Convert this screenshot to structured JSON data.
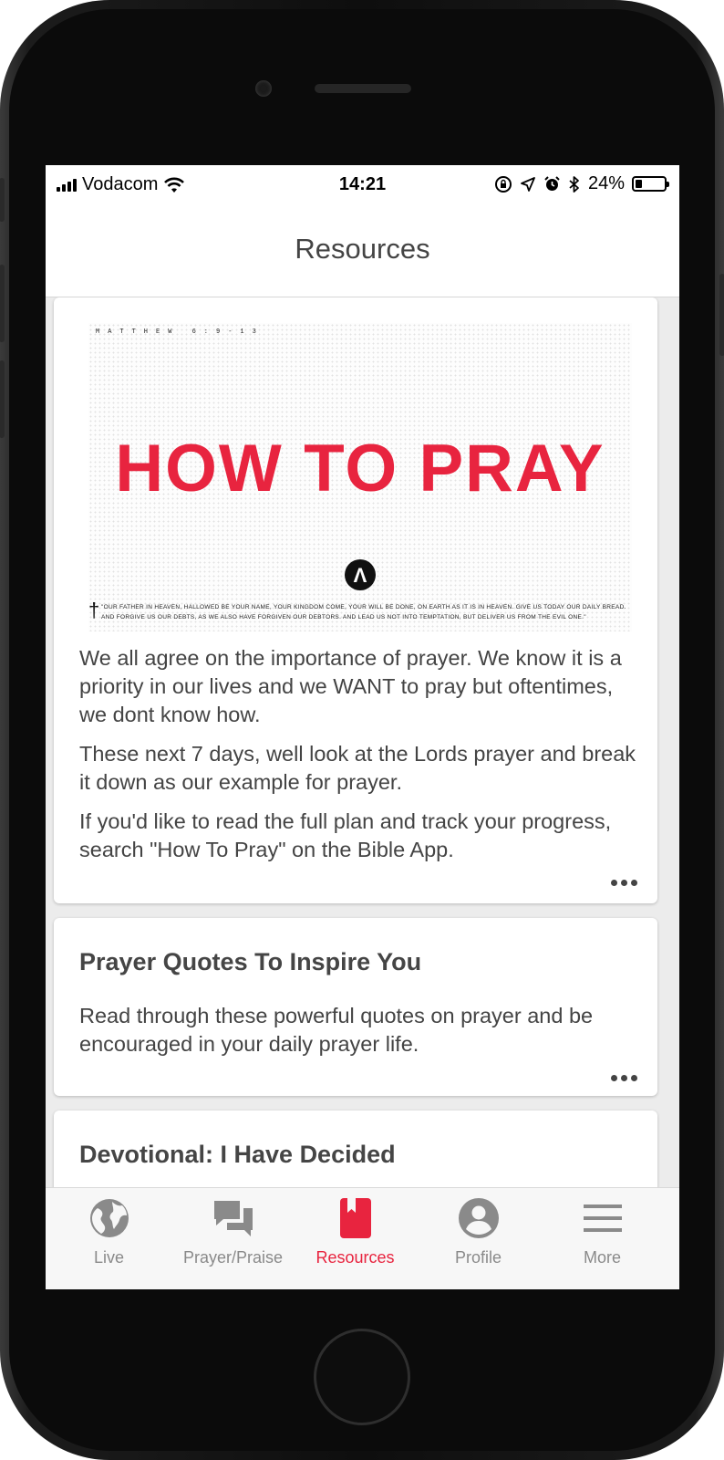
{
  "status_bar": {
    "carrier": "Vodacom",
    "time": "14:21",
    "battery": "24%",
    "battery_level": 0.24,
    "icons": [
      "signal-icon",
      "wifi-icon",
      "orientation-lock-icon",
      "location-icon",
      "alarm-icon",
      "bluetooth-icon",
      "battery-icon"
    ]
  },
  "nav": {
    "title": "Resources"
  },
  "cards": [
    {
      "image": {
        "verse": "MATTHEW 6:9-13",
        "title": "HOW TO PRAY",
        "logo_glyph": "Λ",
        "prayer": "\"OUR FATHER IN HEAVEN, HALLOWED BE YOUR NAME, YOUR KINGDOM COME, YOUR WILL BE DONE, ON EARTH AS IT IS IN HEAVEN. GIVE US TODAY OUR DAILY BREAD. AND FORGIVE US OUR DEBTS, AS WE ALSO HAVE FORGIVEN OUR DEBTORS. AND LEAD US NOT INTO TEMPTATION, BUT DELIVER US FROM THE EVIL ONE.\"",
        "title_color": "#e8243f"
      },
      "paragraphs": [
        "We all agree on the importance of prayer. We know it is a priority in our lives and we WANT to pray but oftentimes, we dont know how.",
        "These next 7 days, well look at the Lords prayer and break it down as our example for prayer.",
        "If you'd like to read the full plan and track your progress, search \"How To Pray\" on the Bible App."
      ]
    },
    {
      "title": "Prayer Quotes To Inspire You",
      "description": "Read through these powerful quotes on prayer and be encouraged in your daily prayer life."
    },
    {
      "title": "Devotional: I Have Decided"
    }
  ],
  "tabs": [
    {
      "label": "Live",
      "icon": "globe-icon"
    },
    {
      "label": "Prayer/Praise",
      "icon": "chat-bubbles-icon"
    },
    {
      "label": "Resources",
      "icon": "bookmark-book-icon"
    },
    {
      "label": "Profile",
      "icon": "user-circle-icon"
    },
    {
      "label": "More",
      "icon": "hamburger-menu-icon"
    }
  ],
  "colors": {
    "accent": "#e8243f",
    "inactive_tab": "#8a8a8a"
  }
}
